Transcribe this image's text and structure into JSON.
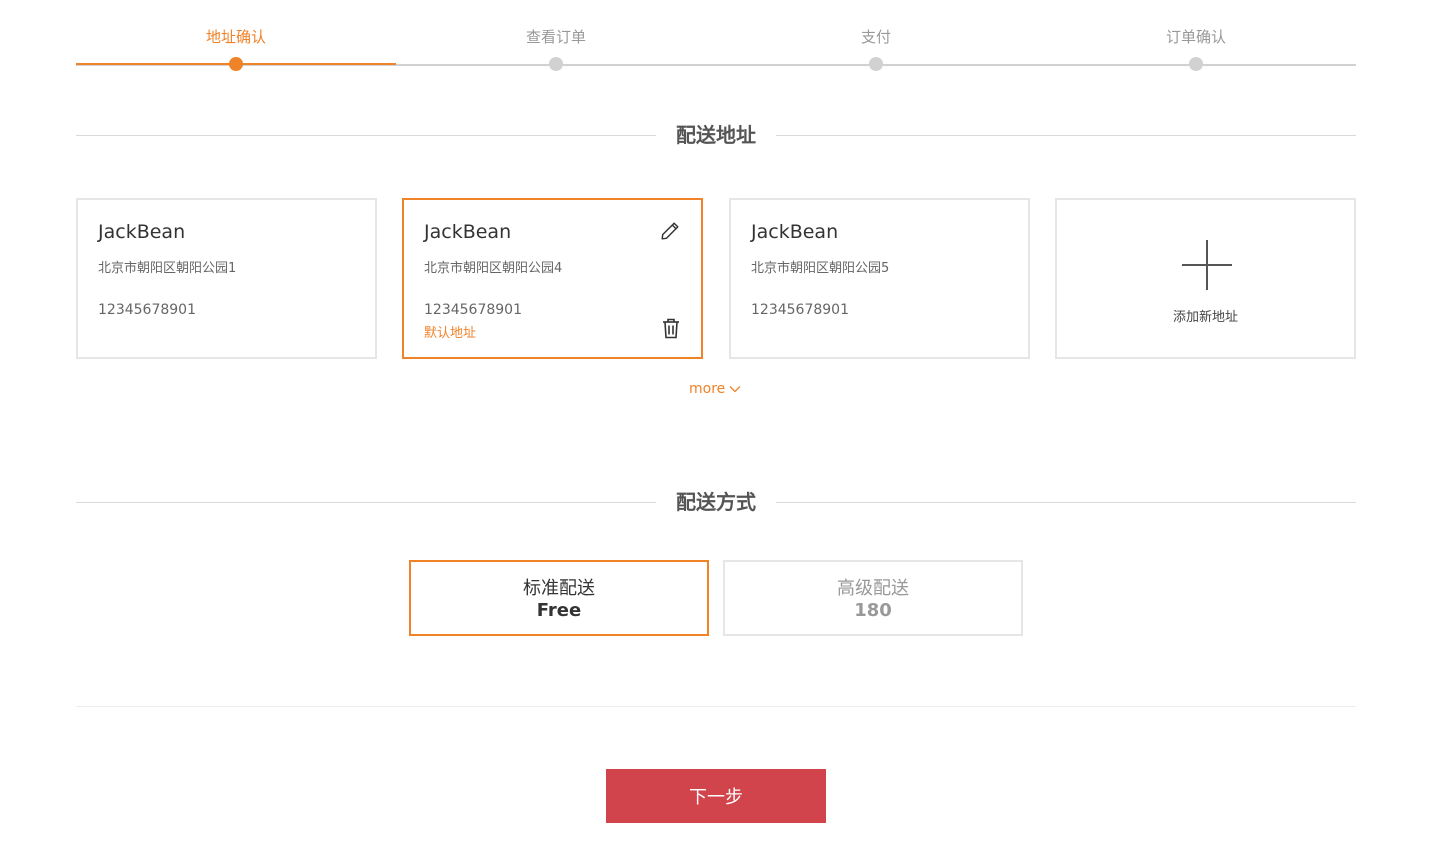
{
  "stepper": {
    "steps": [
      {
        "label": "地址确认",
        "active": true
      },
      {
        "label": "查看订单",
        "active": false
      },
      {
        "label": "支付",
        "active": false
      },
      {
        "label": "订单确认",
        "active": false
      }
    ]
  },
  "address_section": {
    "title": "配送地址",
    "cards": [
      {
        "name": "JackBean",
        "address": "北京市朝阳区朝阳公园1",
        "phone": "12345678901",
        "default_label": "",
        "selected": false
      },
      {
        "name": "JackBean",
        "address": "北京市朝阳区朝阳公园4",
        "phone": "12345678901",
        "default_label": "默认地址",
        "selected": true
      },
      {
        "name": "JackBean",
        "address": "北京市朝阳区朝阳公园5",
        "phone": "12345678901",
        "default_label": "",
        "selected": false
      }
    ],
    "add_label": "添加新地址",
    "more_label": "more"
  },
  "shipping_section": {
    "title": "配送方式",
    "options": [
      {
        "name": "标准配送",
        "price": "Free",
        "selected": true
      },
      {
        "name": "高级配送",
        "price": "180",
        "selected": false
      }
    ]
  },
  "next_button": "下一步",
  "colors": {
    "accent": "#f08228",
    "button": "#d2444c",
    "inactive": "#d1d1d1"
  }
}
